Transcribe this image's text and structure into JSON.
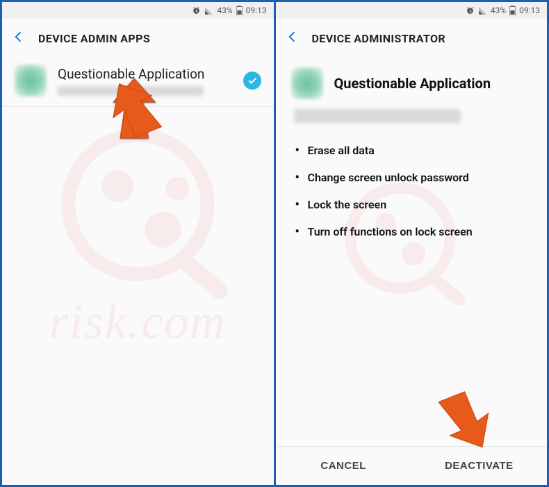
{
  "statusbar": {
    "battery_pct": "43%",
    "time": "09:13"
  },
  "left": {
    "title": "DEVICE ADMIN APPS",
    "app_name": "Questionable Application"
  },
  "right": {
    "title": "DEVICE ADMINISTRATOR",
    "app_name": "Questionable Application",
    "perms": [
      "Erase all data",
      "Change screen unlock password",
      "Lock the screen",
      "Turn off functions on lock screen"
    ],
    "cancel": "CANCEL",
    "deactivate": "DEACTIVATE"
  },
  "watermark": {
    "text": "risk.com"
  }
}
